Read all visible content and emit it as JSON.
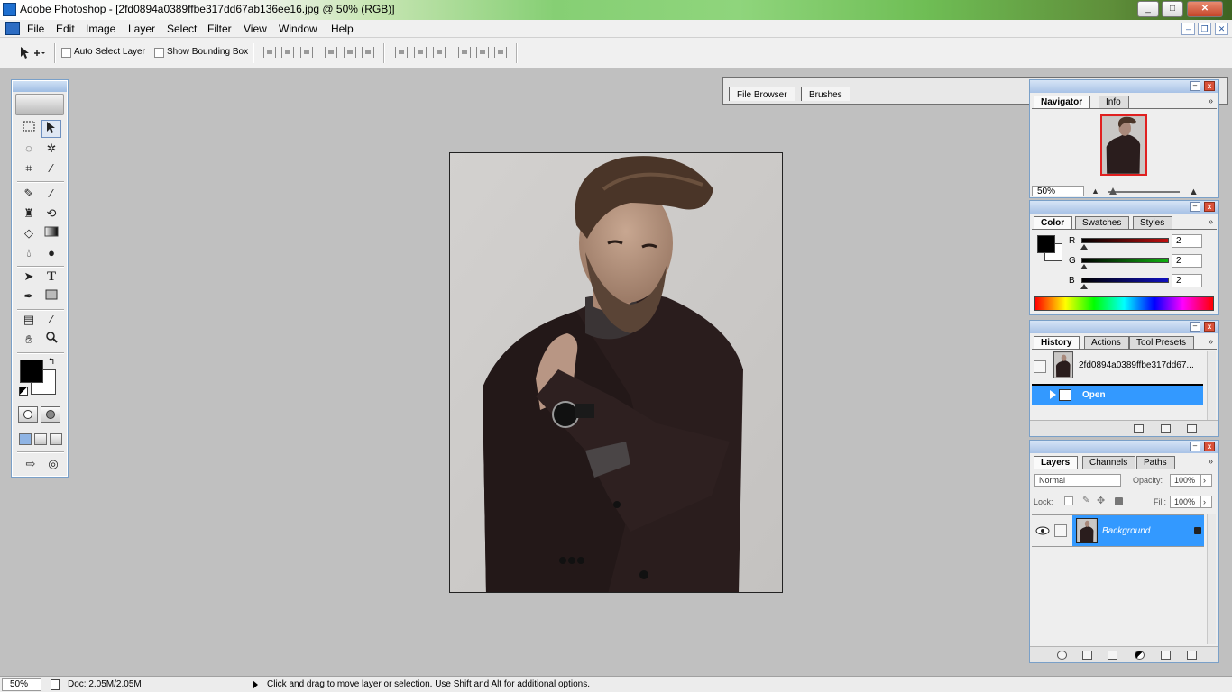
{
  "window": {
    "title": "Adobe Photoshop - [2fd0894a0389ffbe317dd67ab136ee16.jpg @ 50% (RGB)]",
    "controls": {
      "minimize": "_",
      "maximize": "□",
      "close": "✕"
    }
  },
  "menu": {
    "items": [
      "File",
      "Edit",
      "Image",
      "Layer",
      "Select",
      "Filter",
      "View",
      "Window",
      "Help"
    ],
    "doc_controls": {
      "minimize": "–",
      "restore": "❐",
      "close": "✕"
    }
  },
  "options_bar": {
    "tool_icon": "move-tool-icon",
    "auto_select_layer": {
      "label": "Auto Select Layer",
      "checked": false
    },
    "show_bounding_box": {
      "label": "Show Bounding Box",
      "checked": false
    },
    "palette_well_tabs": [
      "File Browser",
      "Brushes"
    ]
  },
  "toolbox": {
    "tools": [
      "rectangular-marquee-tool",
      "move-tool",
      "lasso-tool",
      "magic-wand-tool",
      "crop-tool",
      "slice-tool",
      "healing-brush-tool",
      "brush-tool",
      "clone-stamp-tool",
      "history-brush-tool",
      "eraser-tool",
      "gradient-tool",
      "blur-tool",
      "dodge-tool",
      "path-selection-tool",
      "type-tool",
      "pen-tool",
      "rectangle-tool",
      "notes-tool",
      "eyedropper-tool",
      "hand-tool",
      "zoom-tool"
    ],
    "active_tool": "move-tool",
    "type_tool_glyph": "T",
    "foreground_color": "#000000",
    "background_color": "#ffffff"
  },
  "document": {
    "image_description": "man-in-dark-suit-with-wristwatch",
    "zoom": "50%",
    "mode": "RGB"
  },
  "navigator": {
    "tabs": [
      "Navigator",
      "Info"
    ],
    "active_tab": "Navigator",
    "zoom_value": "50%"
  },
  "color": {
    "tabs": [
      "Color",
      "Swatches",
      "Styles"
    ],
    "active_tab": "Color",
    "channels": [
      {
        "label": "R",
        "value": "2",
        "bar_color": "#c01010"
      },
      {
        "label": "G",
        "value": "2",
        "bar_color": "#10b010"
      },
      {
        "label": "B",
        "value": "2",
        "bar_color": "#1010c0"
      }
    ]
  },
  "history": {
    "tabs": [
      "History",
      "Actions",
      "Tool Presets"
    ],
    "active_tab": "History",
    "snapshot_label": "2fd0894a0389ffbe317dd67...",
    "states": [
      {
        "label": "Open",
        "selected": true
      }
    ]
  },
  "layers": {
    "tabs": [
      "Layers",
      "Channels",
      "Paths"
    ],
    "active_tab": "Layers",
    "blend_mode": "Normal",
    "opacity_label": "Opacity:",
    "opacity_value": "100%",
    "lock_label": "Lock:",
    "fill_label": "Fill:",
    "fill_value": "100%",
    "items": [
      {
        "name": "Background",
        "visible": true,
        "locked": true,
        "selected": true
      }
    ]
  },
  "status_bar": {
    "zoom": "50%",
    "doc_info": "Doc: 2.05M/2.05M",
    "hint": "Click and drag to move layer or selection.  Use Shift and Alt for additional options."
  }
}
